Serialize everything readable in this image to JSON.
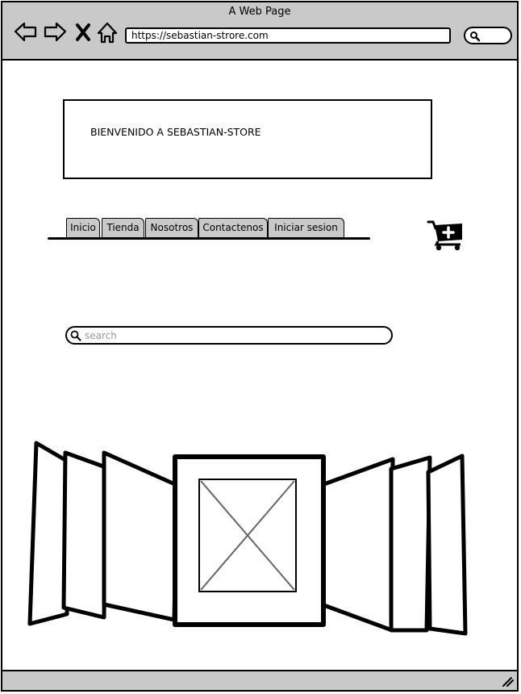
{
  "browser": {
    "window_title": "A Web Page",
    "url": "https://sebastian-strore.com",
    "nav_icons": [
      "back-arrow-icon",
      "forward-arrow-icon",
      "close-icon",
      "home-icon"
    ],
    "search_icon": "search-icon"
  },
  "header": {
    "welcome_text": "BIENVENIDO A SEBASTIAN-STORE"
  },
  "nav_tabs": [
    "Inicio",
    "Tienda",
    "Nosotros",
    "Contactenos",
    "Iniciar sesion"
  ],
  "cart": {
    "icon": "cart-plus-icon"
  },
  "search": {
    "placeholder": "search",
    "icon": "search-icon"
  },
  "carousel": {
    "icon": "image-placeholder-icon"
  },
  "colors": {
    "chrome": "#c9c9c9",
    "stroke": "#000000",
    "placeholder_text": "#999999"
  }
}
